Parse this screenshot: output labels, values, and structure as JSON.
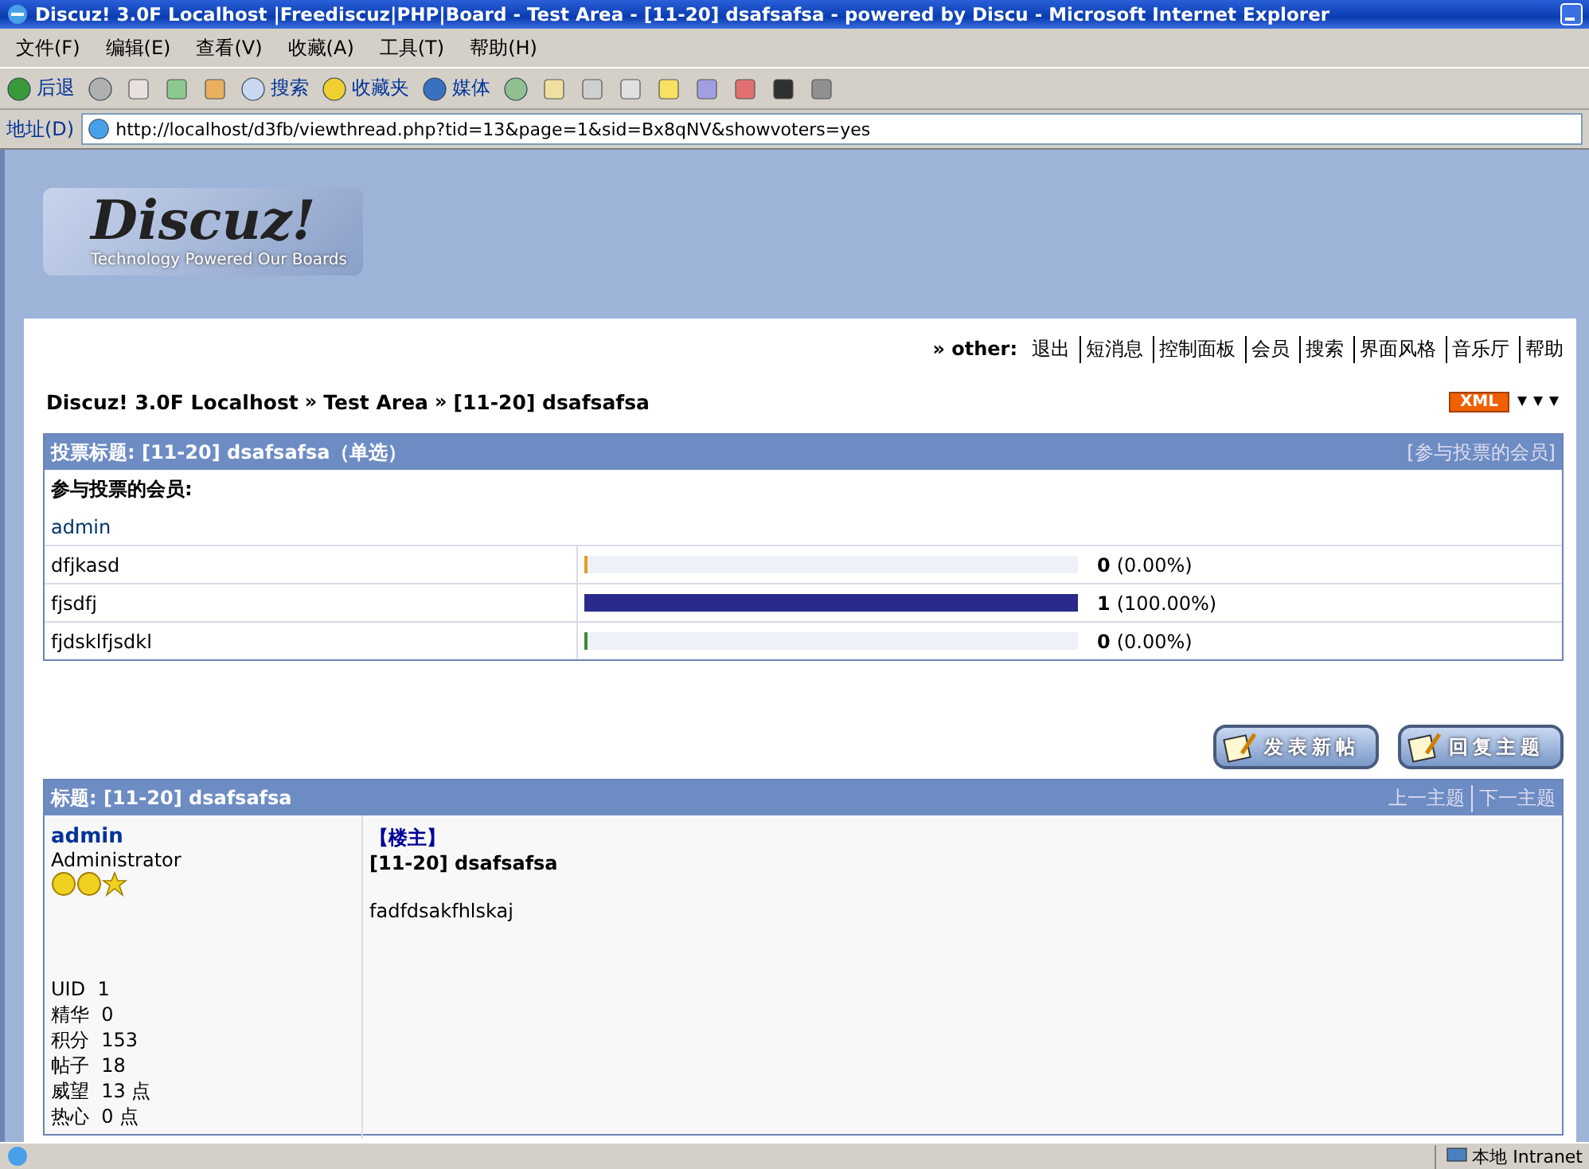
{
  "window": {
    "title": "Discuz! 3.0F Localhost |Freediscuz|PHP|Board - Test Area - [11-20] dsafsafsa - powered by Discu - Microsoft Internet Explorer"
  },
  "menu": [
    "文件(F)",
    "编辑(E)",
    "查看(V)",
    "收藏(A)",
    "工具(T)",
    "帮助(H)"
  ],
  "toolbar": {
    "back": "后退",
    "search": "搜索",
    "favorites": "收藏夹",
    "media": "媒体"
  },
  "address": {
    "label": "地址(D)",
    "url": "http://localhost/d3fb/viewthread.php?tid=13&page=1&sid=Bx8qNV&showvoters=yes"
  },
  "logo": {
    "name": "Discuz!",
    "tagline": "Technology Powered Our Boards"
  },
  "nav": {
    "label": "» other:",
    "links": [
      "退出",
      "短消息",
      "控制面板",
      "会员",
      "搜索",
      "界面风格",
      "音乐厅",
      "帮助"
    ]
  },
  "breadcrumb": [
    {
      "label": "Discuz! 3.0F Localhost"
    },
    {
      "separator": "»",
      "label": "Test Area"
    },
    {
      "separator": "»",
      "label": "[11-20] dsafsafsa"
    }
  ],
  "xml_badge": "XML",
  "poll": {
    "title": "投票标题: [11-20] dsafsafsa（单选）",
    "voters_link": "[参与投票的会员]",
    "voters_label": "参与投票的会员:",
    "voters": [
      "admin"
    ],
    "options": [
      {
        "name": "dfjkasd",
        "count": "0",
        "percent": "(0.00%)",
        "level": 0,
        "color": "#e0a020"
      },
      {
        "name": "fjsdfj",
        "count": "1",
        "percent": "(100.00%)",
        "level": 1,
        "color": "#2a2a8a"
      },
      {
        "name": "fjdsklfjsdkl",
        "count": "0",
        "percent": "(0.00%)",
        "level": 0,
        "color": "#3a8a3a"
      }
    ]
  },
  "actions": [
    "发表新帖",
    "回复主题"
  ],
  "post": {
    "header": "标题: [11-20] dsafsafsa",
    "prev": "上一主题",
    "next": "下一主题",
    "author": "admin",
    "role": "Administrator",
    "floor": "【楼主】",
    "title": "[11-20] dsafsafsa",
    "body": "fadfdsakfhlskaj",
    "stats": [
      {
        "label": "UID",
        "value": "1"
      },
      {
        "label": "精华",
        "value": "0"
      },
      {
        "label": "积分",
        "value": "153"
      },
      {
        "label": "帖子",
        "value": "18"
      },
      {
        "label": "威望",
        "value": "13 点"
      },
      {
        "label": "热心",
        "value": "0 点"
      }
    ]
  },
  "status_bar": {
    "zone": "本地 Intranet"
  }
}
